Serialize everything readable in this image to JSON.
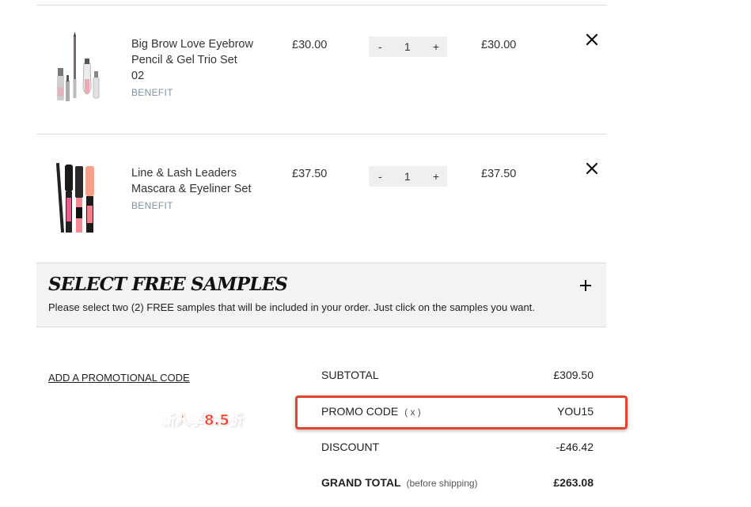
{
  "cart": {
    "items": [
      {
        "name_lines": [
          "Big Brow Love Eyebrow",
          "Pencil & Gel Trio Set",
          "02"
        ],
        "brand": "BENEFIT",
        "price": "£30.00",
        "qty_minus": "-",
        "qty": "1",
        "qty_plus": "+",
        "total": "£30.00"
      },
      {
        "name_lines": [
          "Line & Lash Leaders",
          "Mascara & Eyeliner Set"
        ],
        "brand": "BENEFIT",
        "price": "£37.50",
        "qty_minus": "-",
        "qty": "1",
        "qty_plus": "+",
        "total": "£37.50"
      }
    ]
  },
  "samples": {
    "title": "SELECT FREE SAMPLES",
    "description": "Please select two (2) FREE samples that will be included in your order. Just click on the samples you want."
  },
  "promo": {
    "link_label": "ADD A PROMOTIONAL CODE",
    "annotation": "新人享8.5折"
  },
  "summary": {
    "subtotal_label": "SUBTOTAL",
    "subtotal_value": "£309.50",
    "promo_label": "PROMO CODE",
    "promo_remove": "( x )",
    "promo_value": "YOU15",
    "discount_label": "DISCOUNT",
    "discount_value": "-£46.42",
    "grand_total_label": "GRAND TOTAL",
    "grand_total_note": "(before shipping)",
    "grand_total_value": "£263.08"
  },
  "colors": {
    "brand_text": "#7d93a8",
    "highlight": "#e8432f",
    "panel_bg": "#f3f3f3"
  },
  "icons": [
    "close-icon",
    "plus-icon",
    "product-thumbnail"
  ]
}
